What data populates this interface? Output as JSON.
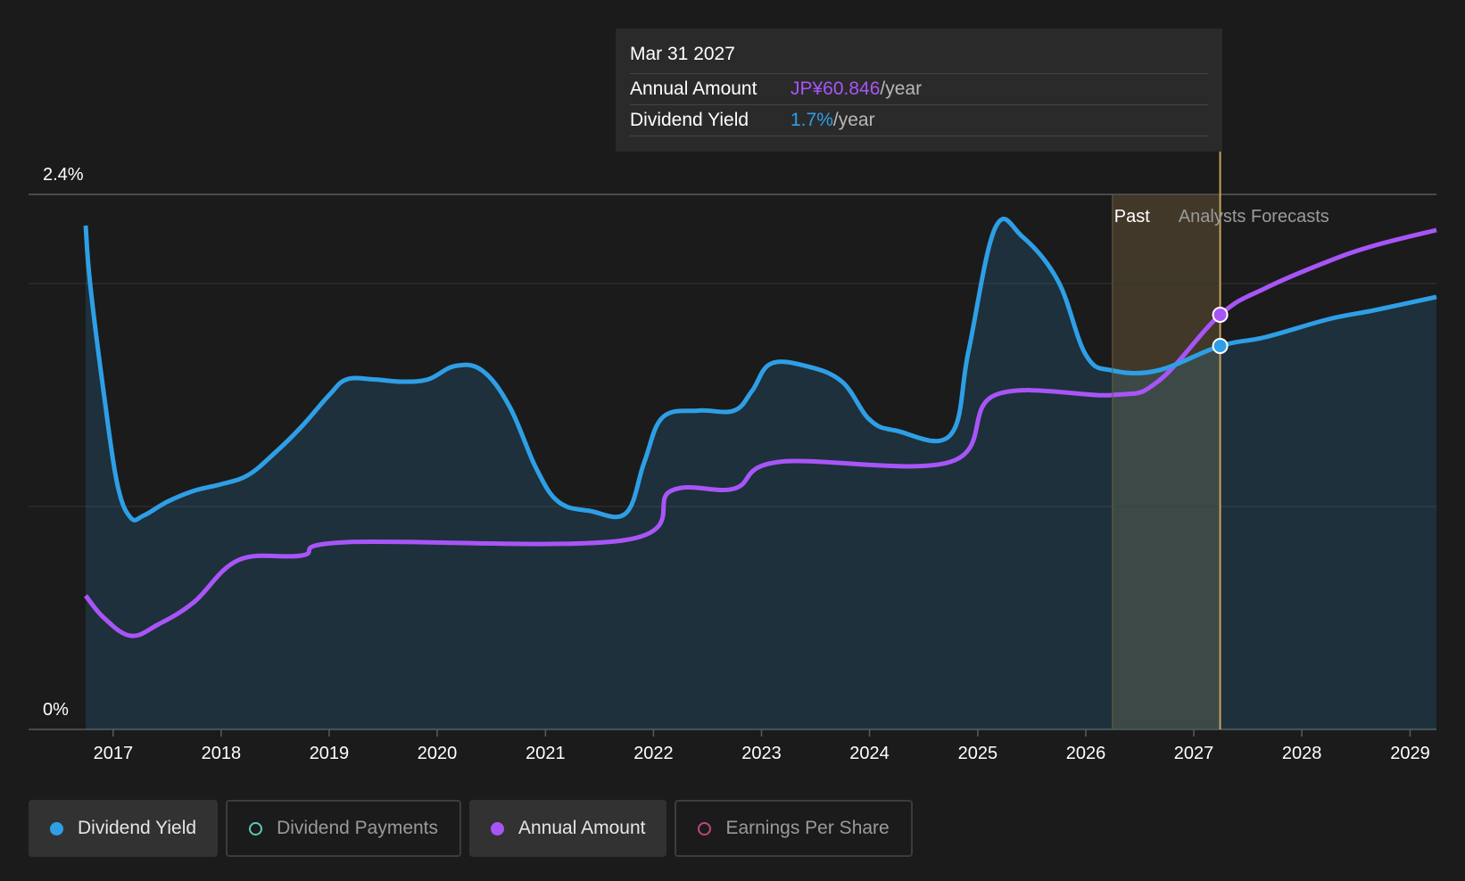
{
  "tooltip": {
    "date": "Mar 31 2027",
    "rows": [
      {
        "label": "Annual Amount",
        "value": "JP¥60.846",
        "suffix": "/year"
      },
      {
        "label": "Dividend Yield",
        "value": "1.7%",
        "suffix": "/year"
      }
    ]
  },
  "legend": [
    {
      "label": "Dividend Yield",
      "color": "#2e9fe6",
      "active": true
    },
    {
      "label": "Dividend Payments",
      "color": "#5ec9b7",
      "active": false
    },
    {
      "label": "Annual Amount",
      "color": "#a855f7",
      "active": true
    },
    {
      "label": "Earnings Per Share",
      "color": "#c2457f",
      "active": false
    }
  ],
  "chart_data": {
    "type": "area",
    "ylim": [
      0,
      2.4
    ],
    "y_tick_labels": [
      "2.4%",
      "0%"
    ],
    "x_tick_labels": [
      "2017",
      "2018",
      "2019",
      "2020",
      "2021",
      "2022",
      "2023",
      "2024",
      "2025",
      "2026",
      "2027",
      "2028",
      "2029"
    ],
    "past_label": "Past",
    "forecast_label": "Analysts Forecasts",
    "past_end": "2026-04-01",
    "highlight_date": "2027-03-31",
    "colors": {
      "yield": "#2e9fe6",
      "amount": "#a855f7",
      "highlight": "#c8a15a"
    },
    "series": [
      {
        "name": "Dividend Yield",
        "points": [
          [
            "2016-09-30",
            2.26
          ],
          [
            "2016-10-15",
            2.0
          ],
          [
            "2016-12-01",
            1.5
          ],
          [
            "2017-01-15",
            1.1
          ],
          [
            "2017-03-01",
            0.95
          ],
          [
            "2017-04-15",
            0.96
          ],
          [
            "2017-07-01",
            1.02
          ],
          [
            "2017-09-30",
            1.07
          ],
          [
            "2018-01-01",
            1.1
          ],
          [
            "2018-04-01",
            1.14
          ],
          [
            "2018-07-01",
            1.24
          ],
          [
            "2018-10-01",
            1.36
          ],
          [
            "2019-01-01",
            1.5
          ],
          [
            "2019-03-01",
            1.57
          ],
          [
            "2019-06-01",
            1.57
          ],
          [
            "2019-09-01",
            1.56
          ],
          [
            "2019-12-01",
            1.57
          ],
          [
            "2020-03-01",
            1.63
          ],
          [
            "2020-06-01",
            1.61
          ],
          [
            "2020-09-01",
            1.45
          ],
          [
            "2020-12-01",
            1.17
          ],
          [
            "2021-02-15",
            1.02
          ],
          [
            "2021-06-01",
            0.98
          ],
          [
            "2021-09-30",
            0.97
          ],
          [
            "2021-12-01",
            1.2
          ],
          [
            "2022-02-01",
            1.4
          ],
          [
            "2022-06-01",
            1.43
          ],
          [
            "2022-09-30",
            1.43
          ],
          [
            "2022-12-01",
            1.52
          ],
          [
            "2023-02-01",
            1.64
          ],
          [
            "2023-06-01",
            1.63
          ],
          [
            "2023-09-30",
            1.56
          ],
          [
            "2024-01-01",
            1.39
          ],
          [
            "2024-04-01",
            1.34
          ],
          [
            "2024-09-30",
            1.32
          ],
          [
            "2024-12-01",
            1.7
          ],
          [
            "2025-03-01",
            2.25
          ],
          [
            "2025-06-01",
            2.21
          ],
          [
            "2025-09-30",
            2.01
          ],
          [
            "2026-01-01",
            1.68
          ],
          [
            "2026-04-01",
            1.61
          ],
          [
            "2026-09-01",
            1.61
          ],
          [
            "2027-03-31",
            1.72
          ],
          [
            "2027-09-01",
            1.76
          ],
          [
            "2028-03-31",
            1.84
          ],
          [
            "2028-09-01",
            1.88
          ],
          [
            "2029-03-31",
            1.94
          ]
        ]
      },
      {
        "name": "Annual Amount",
        "points": [
          [
            "2016-09-30",
            0.6
          ],
          [
            "2016-12-01",
            0.5
          ],
          [
            "2017-03-01",
            0.42
          ],
          [
            "2017-06-01",
            0.47
          ],
          [
            "2017-09-30",
            0.57
          ],
          [
            "2018-03-01",
            0.76
          ],
          [
            "2018-09-30",
            0.78
          ],
          [
            "2019-03-01",
            0.84
          ],
          [
            "2021-09-30",
            0.85
          ],
          [
            "2022-03-01",
            1.07
          ],
          [
            "2022-09-30",
            1.08
          ],
          [
            "2023-03-01",
            1.2
          ],
          [
            "2024-09-30",
            1.2
          ],
          [
            "2025-03-01",
            1.5
          ],
          [
            "2026-04-01",
            1.5
          ],
          [
            "2026-09-01",
            1.56
          ],
          [
            "2027-03-31",
            1.86
          ],
          [
            "2027-09-01",
            1.98
          ],
          [
            "2028-03-31",
            2.1
          ],
          [
            "2028-09-01",
            2.17
          ],
          [
            "2029-03-31",
            2.24
          ]
        ]
      }
    ]
  }
}
